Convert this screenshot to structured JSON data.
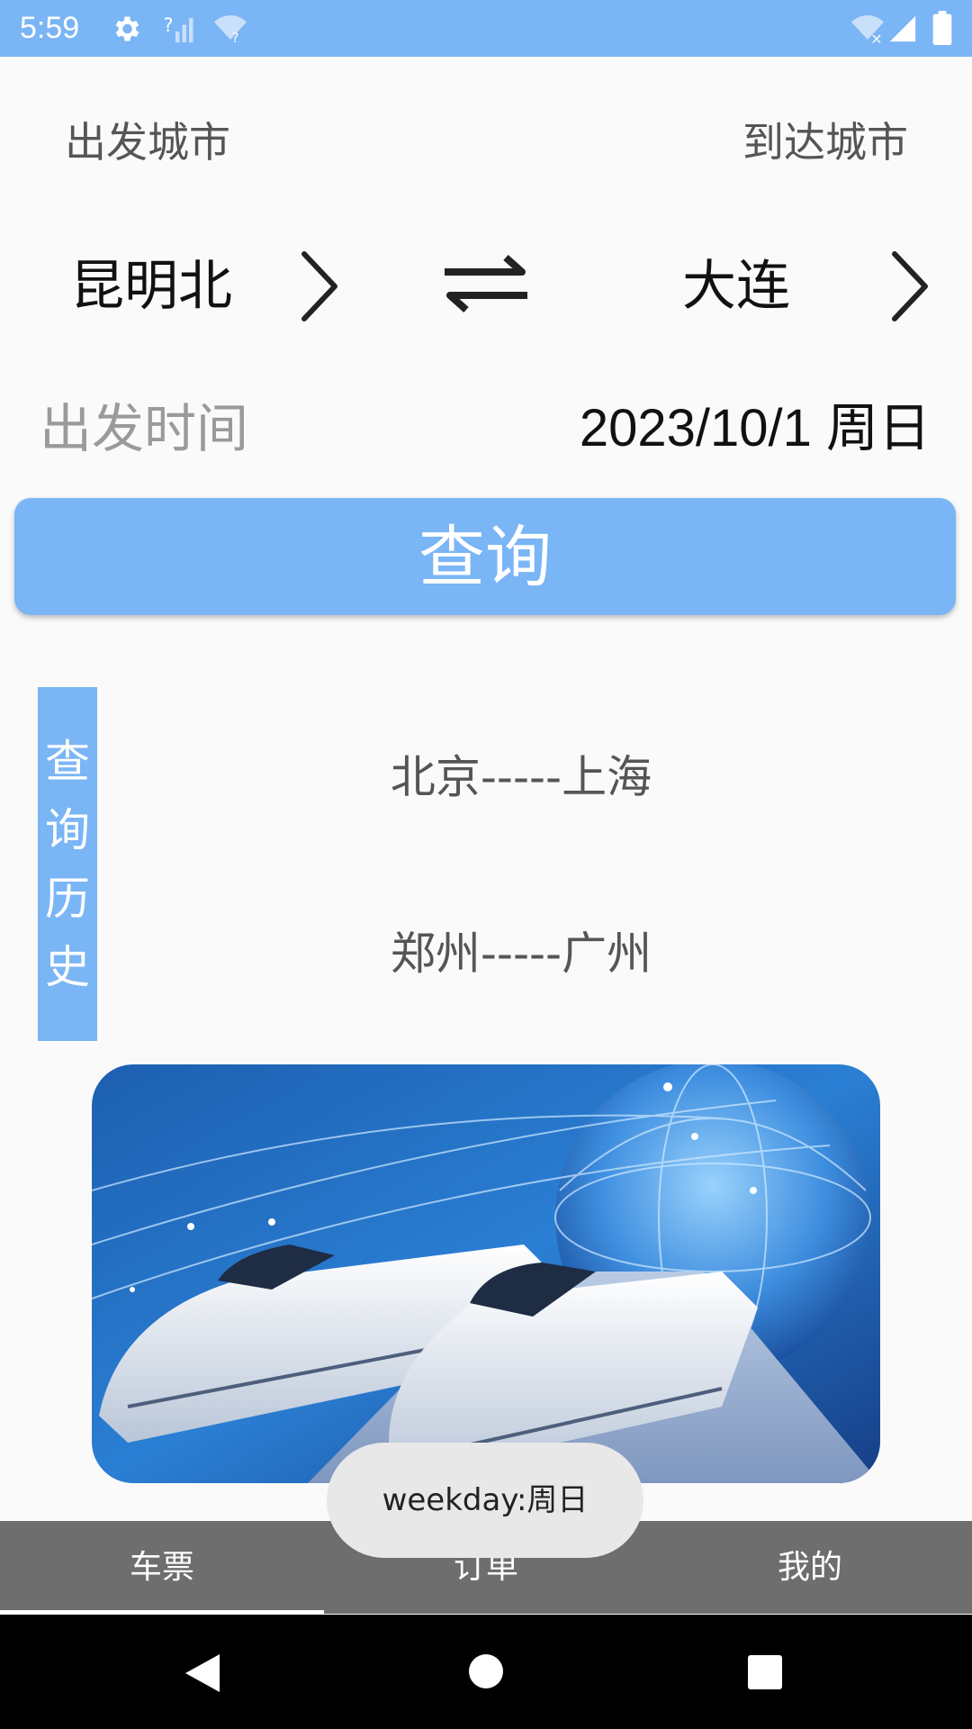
{
  "status_bar": {
    "time": "5:59"
  },
  "form": {
    "depart_label": "出发城市",
    "arrive_label": "到达城市",
    "depart_city": "昆明北",
    "arrive_city": "大连",
    "date_label": "出发时间",
    "date_value": "2023/10/1 周日",
    "query_button": "查询"
  },
  "history": {
    "title_chars": [
      "查",
      "询",
      "历",
      "史"
    ],
    "items": [
      "北京-----上海",
      "郑州-----广州"
    ]
  },
  "toast": "weekday:周日",
  "tabs": [
    "车票",
    "订单",
    "我的"
  ],
  "colors": {
    "accent": "#7ab5f5",
    "tabbar": "#6e6e6e"
  },
  "icons": {
    "status": [
      "gear-icon",
      "signal-unknown-icon",
      "wifi-unknown-icon",
      "wifi-off-icon",
      "signal-icon",
      "battery-icon"
    ],
    "form": [
      "chevron-right-icon",
      "swap-icon"
    ],
    "nav": [
      "back-icon",
      "home-icon",
      "recents-icon"
    ]
  }
}
